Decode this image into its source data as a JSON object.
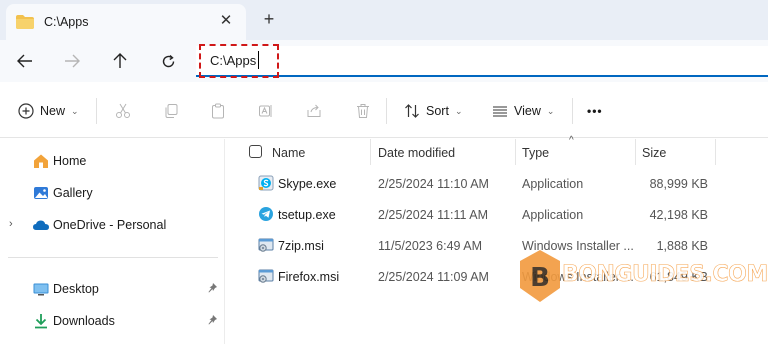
{
  "tab": {
    "title": "C:\\Apps",
    "close_glyph": "✕",
    "new_tab_glyph": "+"
  },
  "address": {
    "value": "C:\\Apps"
  },
  "nav": {
    "back": "arrow-left-icon",
    "forward": "arrow-right-icon",
    "up": "arrow-up-icon",
    "refresh": "refresh-icon"
  },
  "toolbar": {
    "new_label": "New",
    "sort_label": "Sort",
    "view_label": "View",
    "more_glyph": "•••",
    "chevron": "⌄"
  },
  "sidebar": {
    "items": [
      {
        "label": "Home",
        "icon": "home-icon"
      },
      {
        "label": "Gallery",
        "icon": "gallery-icon"
      },
      {
        "label": "OneDrive - Personal",
        "icon": "cloud-icon",
        "expander": "›"
      },
      {
        "label": "Desktop",
        "icon": "desktop-icon"
      },
      {
        "label": "Downloads",
        "icon": "download-icon"
      }
    ]
  },
  "columns": {
    "name": "Name",
    "date": "Date modified",
    "type": "Type",
    "size": "Size",
    "sort_caret": "^"
  },
  "files": [
    {
      "name": "Skype.exe",
      "date": "2/25/2024 11:10 AM",
      "type": "Application",
      "size": "88,999 KB",
      "icon": "skype-icon"
    },
    {
      "name": "tsetup.exe",
      "date": "2/25/2024 11:11 AM",
      "type": "Application",
      "size": "42,198 KB",
      "icon": "telegram-icon"
    },
    {
      "name": "7zip.msi",
      "date": "11/5/2023 6:49 AM",
      "type": "Windows Installer ...",
      "size": "1,888 KB",
      "icon": "msi-icon"
    },
    {
      "name": "Firefox.msi",
      "date": "2/25/2024 11:09 AM",
      "type": "Windows Installer ...",
      "size": "61,849 KB",
      "icon": "msi-icon"
    }
  ],
  "watermark": {
    "text": "BONGUIDES.COM",
    "badge_letter": "B"
  },
  "colors": {
    "accent": "#0067c0",
    "highlight": "#d01818",
    "folder": "#f2c14e",
    "watermark": "#f29a3e"
  }
}
